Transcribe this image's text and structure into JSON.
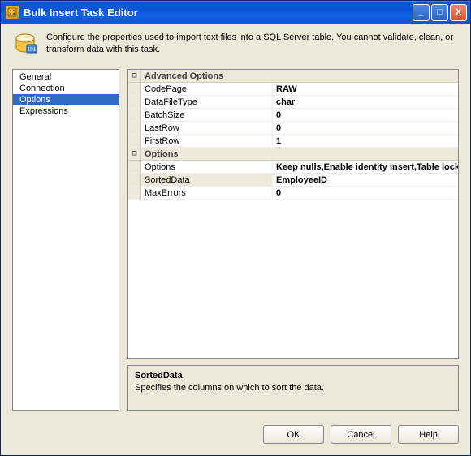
{
  "window": {
    "title": "Bulk Insert Task Editor"
  },
  "info": {
    "text": "Configure the properties used to import text files into a SQL Server table. You cannot validate, clean, or transform data with this task."
  },
  "sidebar": {
    "items": [
      {
        "label": "General",
        "selected": false
      },
      {
        "label": "Connection",
        "selected": false
      },
      {
        "label": "Options",
        "selected": true
      },
      {
        "label": "Expressions",
        "selected": false
      }
    ]
  },
  "groups": [
    {
      "name": "Advanced Options",
      "rows": [
        {
          "name": "CodePage",
          "value": "RAW"
        },
        {
          "name": "DataFileType",
          "value": "char"
        },
        {
          "name": "BatchSize",
          "value": "0"
        },
        {
          "name": "LastRow",
          "value": "0"
        },
        {
          "name": "FirstRow",
          "value": "1"
        }
      ]
    },
    {
      "name": "Options",
      "rows": [
        {
          "name": "Options",
          "value": "Keep nulls,Enable identity insert,Table lock"
        },
        {
          "name": "SortedData",
          "value": "EmployeeID",
          "selected": true
        },
        {
          "name": "MaxErrors",
          "value": "0"
        }
      ]
    }
  ],
  "description": {
    "title": "SortedData",
    "text": "Specifies the columns on which to sort the data."
  },
  "buttons": {
    "ok": "OK",
    "cancel": "Cancel",
    "help": "Help"
  },
  "window_controls": {
    "minimize": "_",
    "maximize": "□",
    "close": "X"
  }
}
